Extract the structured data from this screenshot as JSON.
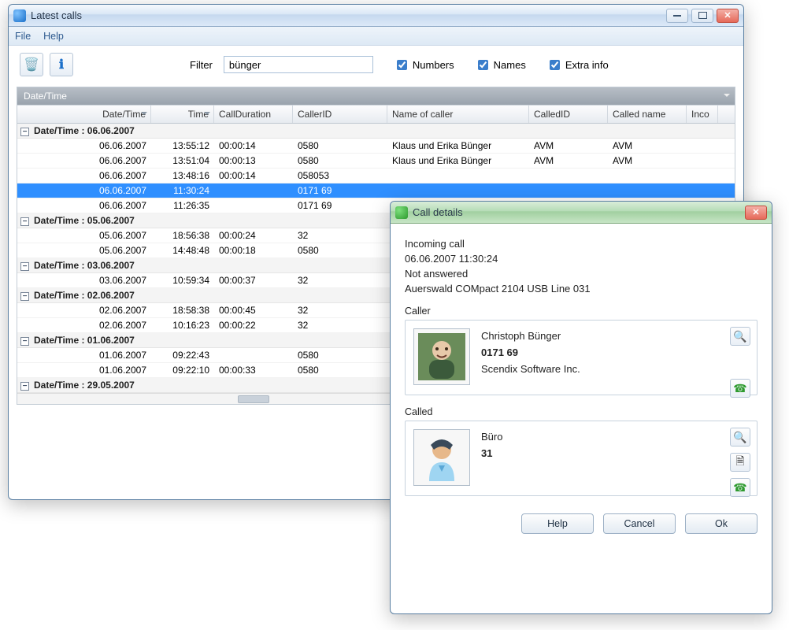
{
  "main": {
    "title": "Latest calls",
    "menu": {
      "file": "File",
      "help": "Help"
    },
    "toolbar": {
      "icon1": "clear-icon",
      "icon2": "info-icon",
      "filter_label": "Filter",
      "filter_value": "bünger",
      "chk_numbers": "Numbers",
      "chk_names": "Names",
      "chk_extra": "Extra info"
    },
    "grid": {
      "group_bar": "Date/Time",
      "headers": {
        "datetime": "Date/Time",
        "time": "Time",
        "duration": "CallDuration",
        "callerid": "CallerID",
        "name": "Name of caller",
        "calledid": "CalledID",
        "calledname": "Called name",
        "incoming": "Inco"
      },
      "groups": [
        {
          "label": "Date/Time : 06.06.2007",
          "rows": [
            {
              "dt": "06.06.2007",
              "t": "13:55:12",
              "d": "00:00:14",
              "cid": "0580",
              "name": "Klaus und Erika Bünger",
              "cdid": "AVM",
              "cdn": "AVM"
            },
            {
              "dt": "06.06.2007",
              "t": "13:51:04",
              "d": "00:00:13",
              "cid": "0580",
              "name": "Klaus und Erika Bünger",
              "cdid": "AVM",
              "cdn": "AVM"
            },
            {
              "dt": "06.06.2007",
              "t": "13:48:16",
              "d": "00:00:14",
              "cid": "058053",
              "name": "",
              "cdid": "",
              "cdn": ""
            },
            {
              "dt": "06.06.2007",
              "t": "11:30:24",
              "d": "",
              "cid": "0171 69",
              "name": "",
              "cdid": "",
              "cdn": "",
              "sel": true
            },
            {
              "dt": "06.06.2007",
              "t": "11:26:35",
              "d": "",
              "cid": "0171 69",
              "name": "",
              "cdid": "",
              "cdn": ""
            }
          ]
        },
        {
          "label": "Date/Time : 05.06.2007",
          "rows": [
            {
              "dt": "05.06.2007",
              "t": "18:56:38",
              "d": "00:00:24",
              "cid": "32",
              "name": "",
              "cdid": "",
              "cdn": ""
            },
            {
              "dt": "05.06.2007",
              "t": "14:48:48",
              "d": "00:00:18",
              "cid": "0580",
              "name": "",
              "cdid": "",
              "cdn": ""
            }
          ]
        },
        {
          "label": "Date/Time : 03.06.2007",
          "rows": [
            {
              "dt": "03.06.2007",
              "t": "10:59:34",
              "d": "00:00:37",
              "cid": "32",
              "name": "",
              "cdid": "",
              "cdn": ""
            }
          ]
        },
        {
          "label": "Date/Time : 02.06.2007",
          "rows": [
            {
              "dt": "02.06.2007",
              "t": "18:58:38",
              "d": "00:00:45",
              "cid": "32",
              "name": "",
              "cdid": "",
              "cdn": ""
            },
            {
              "dt": "02.06.2007",
              "t": "10:16:23",
              "d": "00:00:22",
              "cid": "32",
              "name": "",
              "cdid": "",
              "cdn": ""
            }
          ]
        },
        {
          "label": "Date/Time : 01.06.2007",
          "rows": [
            {
              "dt": "01.06.2007",
              "t": "09:22:43",
              "d": "",
              "cid": "0580",
              "name": "",
              "cdid": "",
              "cdn": ""
            },
            {
              "dt": "01.06.2007",
              "t": "09:22:10",
              "d": "00:00:33",
              "cid": "0580",
              "name": "",
              "cdid": "",
              "cdn": ""
            }
          ]
        },
        {
          "label": "Date/Time : 29.05.2007",
          "rows": []
        }
      ]
    }
  },
  "dlg": {
    "title": "Call details",
    "info": {
      "type": "Incoming call",
      "datetime": "06.06.2007 11:30:24",
      "status": "Not answered",
      "line": "Auerswald COMpact 2104 USB Line 031"
    },
    "caller_title": "Caller",
    "caller": {
      "name": "Christoph Bünger",
      "number": "0171 69",
      "company": "Scendix Software Inc."
    },
    "called_title": "Called",
    "called": {
      "name": "Büro",
      "number": "31"
    },
    "buttons": {
      "help": "Help",
      "cancel": "Cancel",
      "ok": "Ok"
    }
  }
}
